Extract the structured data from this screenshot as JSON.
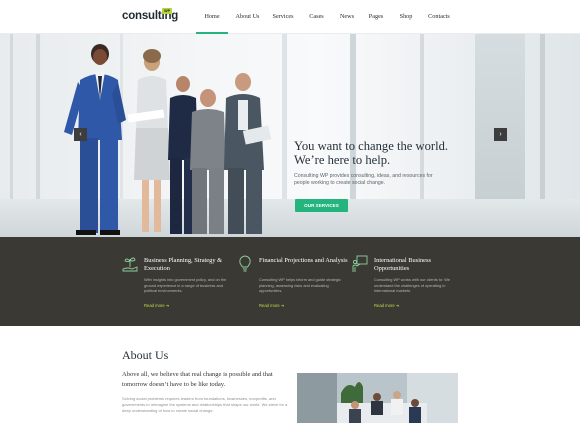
{
  "brand": {
    "name": "consulting",
    "badge": "WP"
  },
  "nav": {
    "items": [
      "Home",
      "About Us",
      "Services",
      "Cases",
      "News",
      "Pages",
      "Shop",
      "Contacts"
    ],
    "active": "Home"
  },
  "hero": {
    "title": "You want to change the world. We’re here to help.",
    "text": "Consulting WP provides consulting, ideas, and resources for people working to create social change.",
    "button": "OUR SERVICES",
    "prev_icon": "chevron-left-icon",
    "next_icon": "chevron-right-icon"
  },
  "services": [
    {
      "icon": "plant-hand-icon",
      "title": "Business Planning, Strategy & Execution",
      "text": "With insights into government policy, and on the ground experience in a range of business and political environments.",
      "link": "Read more"
    },
    {
      "icon": "lightbulb-icon",
      "title": "Financial Projections and Analysis",
      "text": "Consulting WP helps inform and guide strategic planning, assessing risks and evaluating opportunities.",
      "link": "Read more"
    },
    {
      "icon": "presentation-icon",
      "title": "International Business Opportunities",
      "text": "Consulting WP works with our clients to: We understand the challenges of operating in international markets.",
      "link": "Read more"
    }
  ],
  "about": {
    "title": "About Us",
    "lead": "Above all, we believe that real change is possible and that tomorrow doesn’t have to be like today.",
    "text": "Solving social problems requires leaders from foundations, businesses, nonprofits, and governments to reimagine the systems and relationships that shape our world. We strive for a deep understanding of how to create social change."
  },
  "colors": {
    "accent": "#24b47e",
    "dark_band": "#3b3934",
    "link": "#c3d84b",
    "logo_badge": "#b6d43a"
  }
}
